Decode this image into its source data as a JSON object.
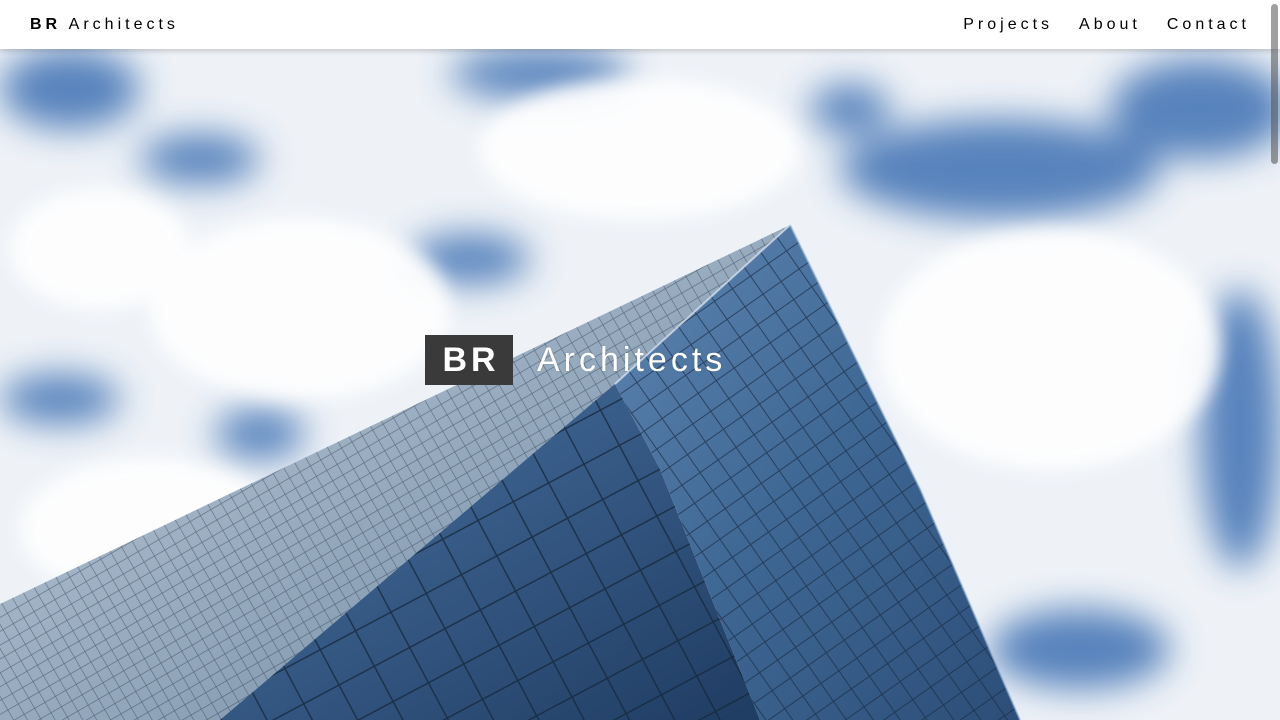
{
  "brand": {
    "initials": "BR",
    "name": "Architects"
  },
  "nav": [
    {
      "label": "Projects"
    },
    {
      "label": "About"
    },
    {
      "label": "Contact"
    }
  ],
  "hero": {
    "initials": "BR",
    "name": "Architects"
  },
  "colors": {
    "nav_bg": "#ffffff",
    "text": "#000000",
    "hero_box": "#3a3a3a",
    "hero_text": "#ffffff",
    "sky_blue": "#3f6fb0"
  }
}
